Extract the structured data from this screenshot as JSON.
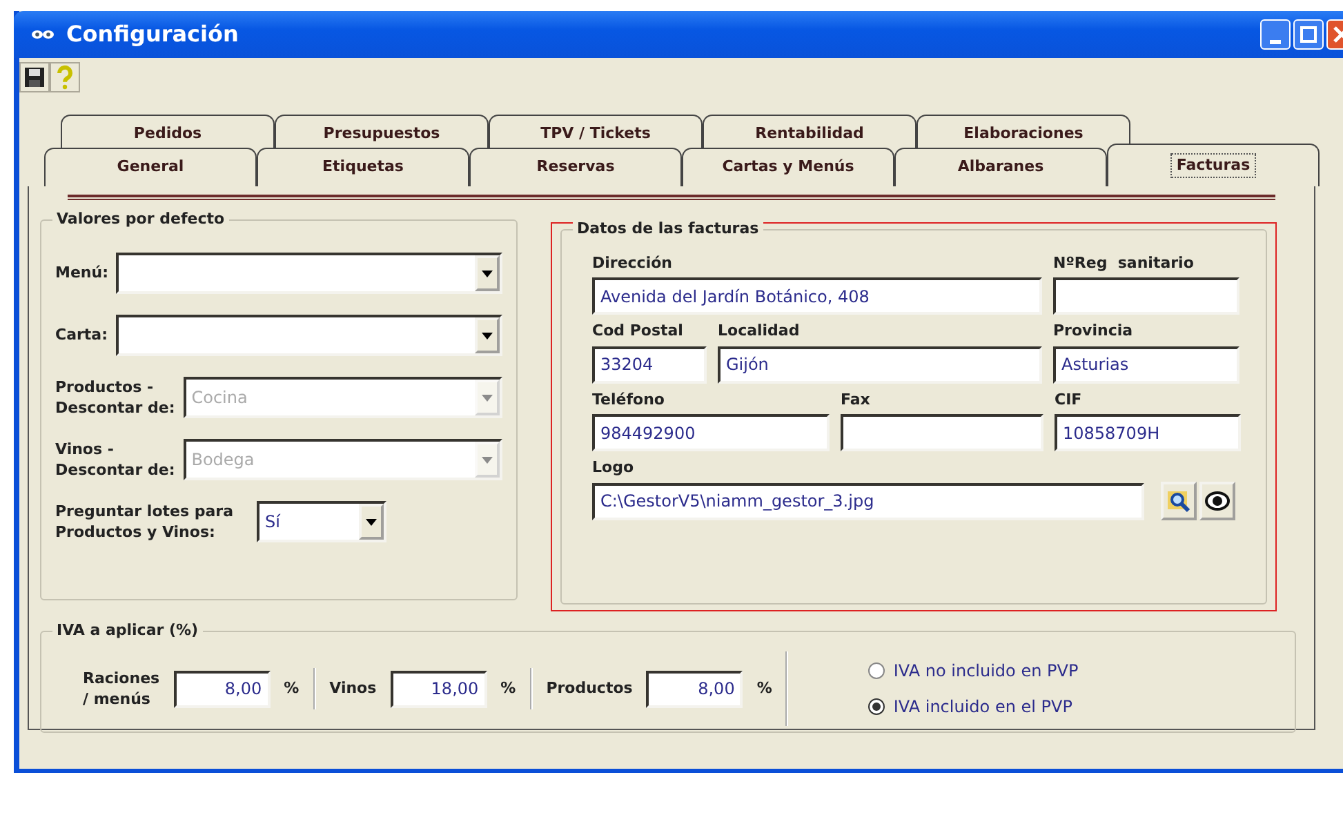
{
  "window": {
    "title": "Configuración"
  },
  "tabs_back": [
    {
      "label": "Pedidos",
      "selected": false
    },
    {
      "label": "Presupuestos",
      "selected": false
    },
    {
      "label": "TPV / Tickets",
      "selected": false
    },
    {
      "label": "Rentabilidad",
      "selected": false
    },
    {
      "label": "Elaboraciones",
      "selected": false
    }
  ],
  "tabs_front": [
    {
      "label": "General",
      "selected": false
    },
    {
      "label": "Etiquetas",
      "selected": false
    },
    {
      "label": "Reservas",
      "selected": false
    },
    {
      "label": "Cartas y Menús",
      "selected": false
    },
    {
      "label": "Albaranes",
      "selected": false
    },
    {
      "label": "Facturas",
      "selected": true
    }
  ],
  "defaults": {
    "title": "Valores por defecto",
    "fields": [
      {
        "label": "Menú:",
        "kind": "combo",
        "disabled": false
      },
      {
        "label": "Carta:",
        "kind": "combo",
        "disabled": false
      },
      {
        "label": "Productos -\nDescontar de:",
        "kind": "combo",
        "value": "Cocina",
        "disabled": true
      },
      {
        "label": "Vinos -\nDescontar de:",
        "kind": "combo",
        "value": "Bodega",
        "disabled": true
      },
      {
        "label": "Preguntar lotes para\nProductos y Vinos:",
        "kind": "narrow",
        "value": "Sí",
        "disabled": false
      }
    ]
  },
  "invoice": {
    "title": "Datos de las facturas",
    "fields": [
      {
        "label": "Dirección",
        "value": "Avenida del Jardín Botánico, 408"
      },
      {
        "label": "NºReg  sanitario"
      },
      {
        "label": "Cod Postal",
        "value": "33204"
      },
      {
        "label": "Localidad",
        "value": "Gijón"
      },
      {
        "label": "Provincia",
        "value": "Asturias"
      },
      {
        "label": "Teléfono",
        "value": "984492900"
      },
      {
        "label": "Fax"
      },
      {
        "label": "CIF",
        "value": "10858709H"
      },
      {
        "label": "Logo",
        "value": "C:\\GestorV5\\niamm_gestor_3.jpg"
      }
    ]
  },
  "iva": {
    "title": "IVA a aplicar (%)",
    "rates": [
      {
        "label": "Raciones\n/ menús",
        "value": "8,00",
        "unit": "%"
      },
      {
        "label": "Vinos",
        "value": "18,00",
        "unit": "%"
      },
      {
        "label": "Productos",
        "value": "8,00",
        "unit": "%"
      }
    ],
    "options": [
      {
        "label": "IVA no incluido en PVP",
        "selected": false
      },
      {
        "label": "IVA incluido en el PVP",
        "selected": true
      }
    ]
  }
}
